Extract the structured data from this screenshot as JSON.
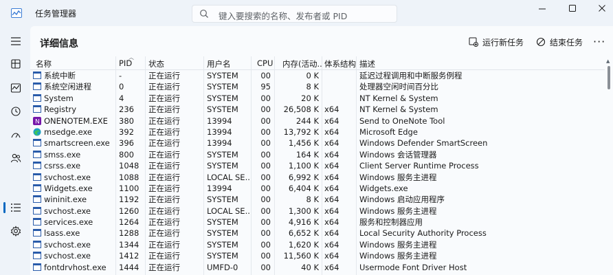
{
  "window": {
    "title": "任务管理器",
    "search_placeholder": "键入要搜索的名称、发布者或 PID"
  },
  "toolbar": {
    "page_title": "详细信息",
    "run_new_task": "运行新任务",
    "end_task": "结束任务"
  },
  "columns": {
    "name": "名称",
    "pid": "PID",
    "status": "状态",
    "user": "用户名",
    "cpu": "CPU",
    "memory": "内存(活动...",
    "arch": "体系结构",
    "desc": "描述"
  },
  "rows": [
    {
      "icon": "process-icon",
      "name": "系统中断",
      "pid": "-",
      "status": "正在运行",
      "user": "SYSTEM",
      "cpu": "00",
      "mem": "0 K",
      "arch": "",
      "desc": "延迟过程调用和中断服务例程"
    },
    {
      "icon": "process-icon",
      "name": "系统空闲进程",
      "pid": "0",
      "status": "正在运行",
      "user": "SYSTEM",
      "cpu": "95",
      "mem": "8 K",
      "arch": "",
      "desc": "处理器空闲时间百分比"
    },
    {
      "icon": "process-icon",
      "name": "System",
      "pid": "4",
      "status": "正在运行",
      "user": "SYSTEM",
      "cpu": "00",
      "mem": "20 K",
      "arch": "",
      "desc": "NT Kernel & System"
    },
    {
      "icon": "process-icon",
      "name": "Registry",
      "pid": "236",
      "status": "正在运行",
      "user": "SYSTEM",
      "cpu": "00",
      "mem": "26,508 K",
      "arch": "x64",
      "desc": "NT Kernel & System"
    },
    {
      "icon": "onenote-icon",
      "name": "ONENOTEM.EXE",
      "pid": "380",
      "status": "正在运行",
      "user": "13994",
      "cpu": "00",
      "mem": "244 K",
      "arch": "x64",
      "desc": "Send to OneNote Tool"
    },
    {
      "icon": "edge-icon",
      "name": "msedge.exe",
      "pid": "392",
      "status": "正在运行",
      "user": "13994",
      "cpu": "00",
      "mem": "13,792 K",
      "arch": "x64",
      "desc": "Microsoft Edge"
    },
    {
      "icon": "process-icon",
      "name": "smartscreen.exe",
      "pid": "396",
      "status": "正在运行",
      "user": "13994",
      "cpu": "00",
      "mem": "1,456 K",
      "arch": "x64",
      "desc": "Windows Defender SmartScreen"
    },
    {
      "icon": "process-icon",
      "name": "smss.exe",
      "pid": "800",
      "status": "正在运行",
      "user": "SYSTEM",
      "cpu": "00",
      "mem": "164 K",
      "arch": "x64",
      "desc": "Windows 会话管理器"
    },
    {
      "icon": "process-icon",
      "name": "csrss.exe",
      "pid": "1048",
      "status": "正在运行",
      "user": "SYSTEM",
      "cpu": "00",
      "mem": "1,100 K",
      "arch": "x64",
      "desc": "Client Server Runtime Process"
    },
    {
      "icon": "process-icon",
      "name": "svchost.exe",
      "pid": "1088",
      "status": "正在运行",
      "user": "LOCAL SE...",
      "cpu": "00",
      "mem": "6,992 K",
      "arch": "x64",
      "desc": "Windows 服务主进程"
    },
    {
      "icon": "process-icon",
      "name": "Widgets.exe",
      "pid": "1100",
      "status": "正在运行",
      "user": "13994",
      "cpu": "00",
      "mem": "6,404 K",
      "arch": "x64",
      "desc": "Widgets.exe"
    },
    {
      "icon": "process-icon",
      "name": "wininit.exe",
      "pid": "1192",
      "status": "正在运行",
      "user": "SYSTEM",
      "cpu": "00",
      "mem": "8 K",
      "arch": "x64",
      "desc": "Windows 启动应用程序"
    },
    {
      "icon": "process-icon",
      "name": "svchost.exe",
      "pid": "1260",
      "status": "正在运行",
      "user": "LOCAL SE...",
      "cpu": "00",
      "mem": "1,300 K",
      "arch": "x64",
      "desc": "Windows 服务主进程"
    },
    {
      "icon": "process-icon",
      "name": "services.exe",
      "pid": "1264",
      "status": "正在运行",
      "user": "SYSTEM",
      "cpu": "00",
      "mem": "4,916 K",
      "arch": "x64",
      "desc": "服务和控制器应用"
    },
    {
      "icon": "process-icon",
      "name": "lsass.exe",
      "pid": "1288",
      "status": "正在运行",
      "user": "SYSTEM",
      "cpu": "00",
      "mem": "6,652 K",
      "arch": "x64",
      "desc": "Local Security Authority Process"
    },
    {
      "icon": "process-icon",
      "name": "svchost.exe",
      "pid": "1344",
      "status": "正在运行",
      "user": "SYSTEM",
      "cpu": "00",
      "mem": "1,620 K",
      "arch": "x64",
      "desc": "Windows 服务主进程"
    },
    {
      "icon": "process-icon",
      "name": "svchost.exe",
      "pid": "1412",
      "status": "正在运行",
      "user": "SYSTEM",
      "cpu": "00",
      "mem": "11,560 K",
      "arch": "x64",
      "desc": "Windows 服务主进程"
    },
    {
      "icon": "process-icon",
      "name": "fontdrvhost.exe",
      "pid": "1444",
      "status": "正在运行",
      "user": "UMFD-0",
      "cpu": "00",
      "mem": "40 K",
      "arch": "x64",
      "desc": "Usermode Font Driver Host"
    }
  ],
  "colors": {
    "accent": "#0067c0",
    "background": "#eef3f9",
    "panel": "#f9fbfd"
  }
}
